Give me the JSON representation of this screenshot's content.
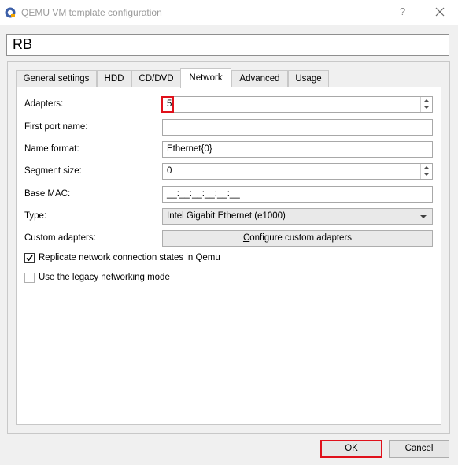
{
  "window": {
    "title": "QEMU VM template configuration",
    "help_glyph": "?",
    "icons": {
      "app": "qemu-app-icon",
      "close": "close-icon"
    }
  },
  "vm_name": "RB",
  "tabs": [
    {
      "label": "General settings",
      "active": false
    },
    {
      "label": "HDD",
      "active": false
    },
    {
      "label": "CD/DVD",
      "active": false
    },
    {
      "label": "Network",
      "active": true
    },
    {
      "label": "Advanced",
      "active": false
    },
    {
      "label": "Usage",
      "active": false
    }
  ],
  "network": {
    "adapters": {
      "label": "Adapters:",
      "value": "5"
    },
    "first_port_name": {
      "label": "First port name:",
      "value": ""
    },
    "name_format": {
      "label": "Name format:",
      "value": "Ethernet{0}"
    },
    "segment_size": {
      "label": "Segment size:",
      "value": "0"
    },
    "base_mac": {
      "label": "Base MAC:",
      "value": "__:__:__:__:__:__"
    },
    "type": {
      "label": "Type:",
      "value": "Intel Gigabit Ethernet (e1000)"
    },
    "custom_adapters": {
      "label": "Custom adapters:",
      "button": "Configure custom adapters"
    },
    "replicate_states": {
      "label": "Replicate network connection states in Qemu",
      "checked": true
    },
    "legacy_networking": {
      "label": "Use the legacy networking mode",
      "checked": false
    }
  },
  "buttons": {
    "ok": "OK",
    "cancel": "Cancel"
  },
  "colors": {
    "highlight": "#e0111b",
    "accent": "#3c5fa8"
  }
}
